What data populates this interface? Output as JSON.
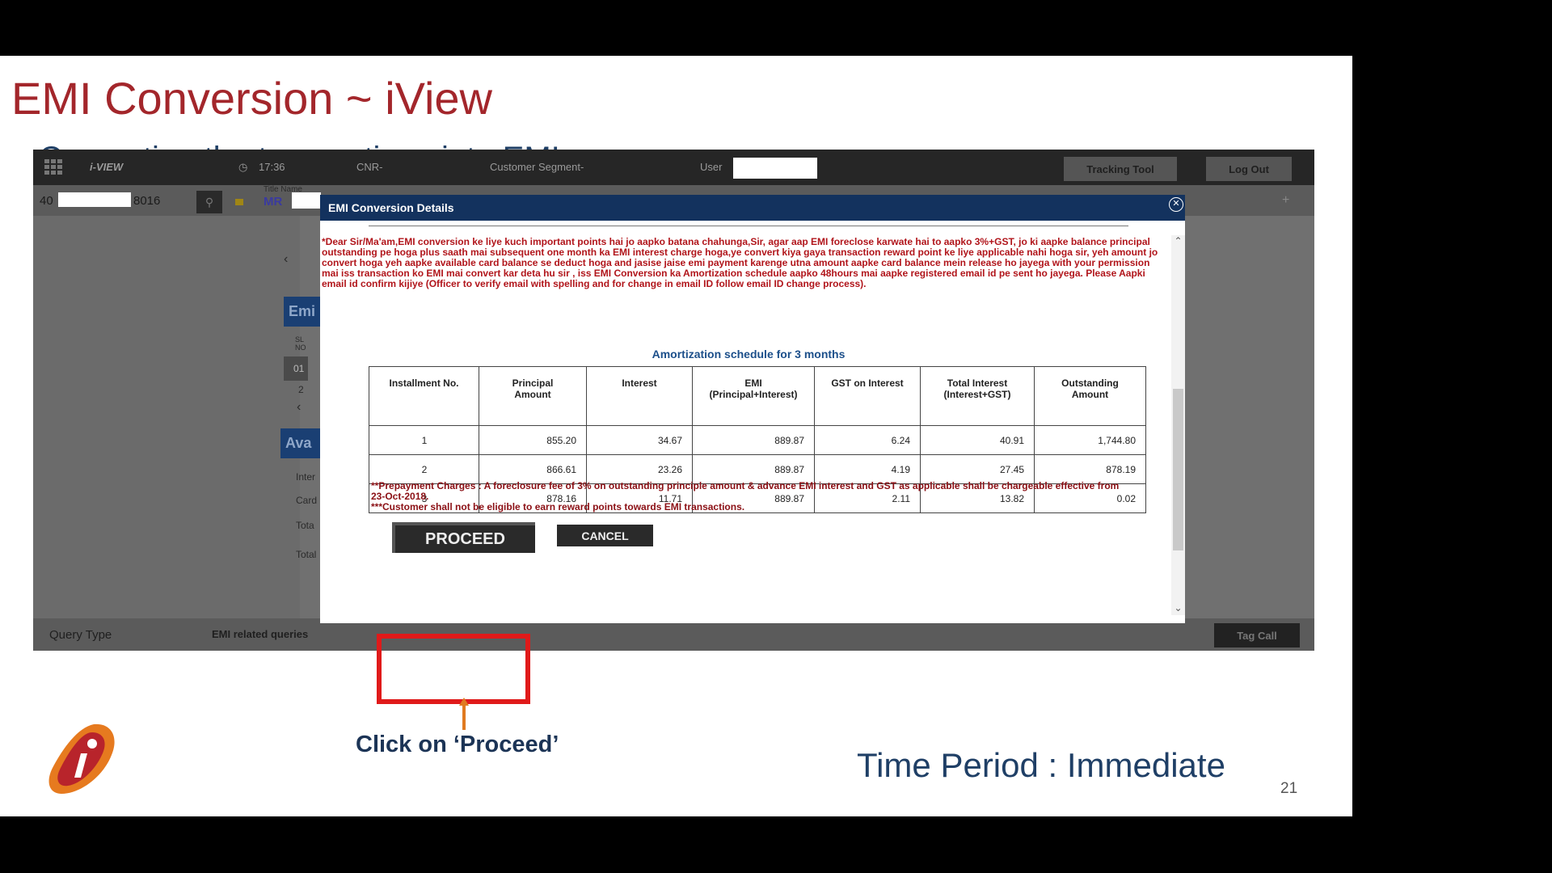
{
  "slide": {
    "title": "EMI Conversion ~ iView",
    "subtitle": "Converting the transactions into EMI",
    "callout": "Click on ‘Proceed’",
    "time_period": "Time Period : Immediate",
    "page_number": "21"
  },
  "app": {
    "topbar": {
      "brand": "i-VIEW",
      "time": "17:36",
      "cnr": "CNR-",
      "customer_segment": "Customer Segment-",
      "user_label": "User",
      "tracking_tool": "Tracking Tool",
      "log_out": "Log Out"
    },
    "account": {
      "prefix": "40",
      "suffix": "8016",
      "title_label": "Title  Name",
      "salutation": "MR"
    },
    "side": {
      "emi_tab": "Emi",
      "sl_no": "SL NO",
      "row1": "01",
      "row2": "2",
      "available_tab": "Ava",
      "interest": "Inter",
      "card": "Card",
      "total": "Tota",
      "total2": "Total"
    },
    "bottom": {
      "query_type": "Query Type",
      "query_value": "EMI related queries",
      "tag_call": "Tag Call"
    }
  },
  "modal": {
    "title": "EMI Conversion Details",
    "notice": "*Dear Sir/Ma'am,EMI conversion ke liye kuch important points hai jo aapko batana chahunga,Sir, agar aap EMI foreclose karwate hai to aapko 3%+GST, jo ki aapke balance principal outstanding pe hoga plus saath mai subsequent one month ka EMI interest charge hoga,ye convert kiya gaya transaction reward point ke liye applicable nahi hoga sir, yeh amount jo convert hoga yeh aapke available card balance se deduct hoga and jasise jaise emi payment karenge utna amount aapke card balance mein release ho jayega with your permission mai iss transaction ko EMI mai convert kar deta hu sir , iss EMI Conversion ka Amortization schedule aapko 48hours mai aapke registered email id pe sent ho jayega. Please Aapki email id confirm kijiye (Officer to verify email with spelling and for change in email ID follow email ID change process).",
    "amortization_title": "Amortization schedule for 3 months",
    "table": {
      "headers": [
        [
          "Installment No.",
          ""
        ],
        [
          "Principal",
          "Amount"
        ],
        [
          "Interest",
          ""
        ],
        [
          "EMI",
          "(Principal+Interest)"
        ],
        [
          "GST on Interest",
          ""
        ],
        [
          "Total Interest",
          "(Interest+GST)"
        ],
        [
          "Outstanding",
          "Amount"
        ]
      ],
      "rows": [
        [
          "1",
          "855.20",
          "34.67",
          "889.87",
          "6.24",
          "40.91",
          "1,744.80"
        ],
        [
          "2",
          "866.61",
          "23.26",
          "889.87",
          "4.19",
          "27.45",
          "878.19"
        ],
        [
          "3",
          "878.16",
          "11.71",
          "889.87",
          "2.11",
          "13.82",
          "0.02"
        ]
      ]
    },
    "footnote_prepayment": "**Prepayment Charges : A foreclosure fee of 3% on outstanding principle amount & advance EMI interest and GST as applicable shall be chargeable effective from 23-Oct-2018.",
    "footnote_reward": "***Customer shall not be eligible to earn reward points towards EMI transactions.",
    "proceed": "PROCEED",
    "cancel": "CANCEL"
  },
  "colors": {
    "title_red": "#a3262b",
    "subtitle_blue": "#1f3f66",
    "modal_header": "#13325e",
    "highlight": "#e01a1a"
  }
}
